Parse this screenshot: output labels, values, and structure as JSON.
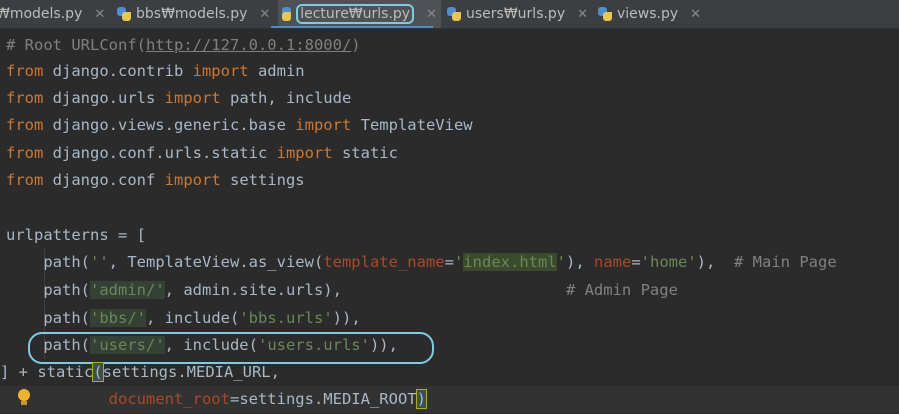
{
  "tabs": [
    {
      "label": "₩models.py",
      "active": false
    },
    {
      "label": "bbs₩models.py",
      "active": false
    },
    {
      "label": "lecture₩urls.py",
      "active": true
    },
    {
      "label": "users₩urls.py",
      "active": false
    },
    {
      "label": "views.py",
      "active": false
    }
  ],
  "close_glyph": "✕",
  "code": {
    "comment_prefix": "# Root URLConf(",
    "comment_url": "http://127.0.0.1:8000/",
    "comment_suffix": ")",
    "import_lines": [
      {
        "from": "from",
        "module": " django.contrib ",
        "import": "import",
        "names": " admin"
      },
      {
        "from": "from",
        "module": " django.urls ",
        "import": "import",
        "names": " path, include"
      },
      {
        "from": "from",
        "module": " django.views.generic.base ",
        "import": "import",
        "names": " TemplateView"
      },
      {
        "from": "from",
        "module": " django.conf.urls.static ",
        "import": "import",
        "names": " static"
      },
      {
        "from": "from",
        "module": " django.conf ",
        "import": "import",
        "names": " settings"
      }
    ],
    "urlpatterns_open": "urlpatterns = [",
    "line_home": {
      "a": "    path(",
      "s1": "''",
      "b": ", TemplateView.as_view(",
      "p1": "template_name",
      "eq1": "=",
      "q1": "'",
      "s2": "index.html",
      "q2": "'",
      "c": "), ",
      "p2": "name",
      "eq2": "=",
      "s3": "'home'",
      "d": "),  ",
      "cmt": "# Main Page"
    },
    "line_admin": {
      "a": "    path(",
      "s1": "'admin/'",
      "b": ", admin.site.urls),",
      "pad": "                        ",
      "cmt": "# Admin Page"
    },
    "line_bbs": {
      "a": "    path(",
      "s1": "'bbs/'",
      "b": ", include(",
      "s2": "'bbs.urls'",
      "c": ")),"
    },
    "line_users": {
      "a": "    path(",
      "s1": "'users/'",
      "b": ", include(",
      "s2": "'users.urls'",
      "c": ")),"
    },
    "line_static": {
      "a": "] + static",
      "paren": "(",
      "b": "settings.MEDIA_URL,"
    },
    "line_docroot": {
      "indent": "           ",
      "p": "document_root",
      "b": "=settings.MEDIA_ROOT",
      "paren": ")"
    }
  },
  "colors": {
    "background": "#2b2b2b",
    "keyword": "#cc7832",
    "string": "#6a8759",
    "comment": "#808080",
    "param": "#aa4926",
    "annotation_outline": "#7ecbe6"
  },
  "icons": {
    "file": "python-file-icon",
    "hint": "lightbulb-icon"
  }
}
